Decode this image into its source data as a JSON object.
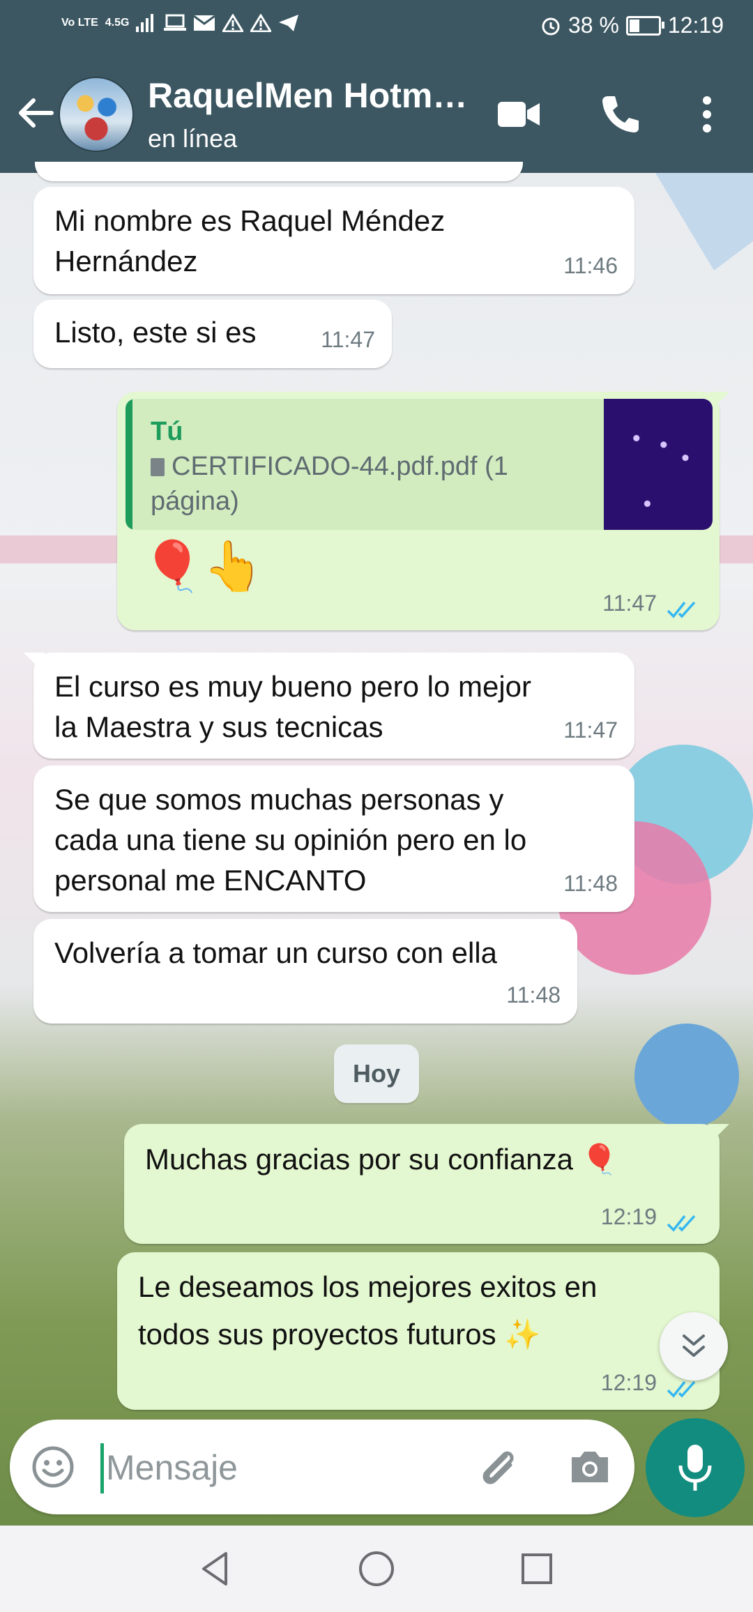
{
  "status_bar": {
    "network_labels": [
      "Vo LTE",
      "4.5G"
    ],
    "battery_percent": "38 %",
    "battery_level": 0.38,
    "time": "12:19"
  },
  "header": {
    "contact_name": "RaquelMen Hotm…",
    "contact_status": "en línea"
  },
  "messages": [
    {
      "direction": "in",
      "text": "Mi nombre es Raquel Méndez\nHernández",
      "time": "11:46"
    },
    {
      "direction": "in",
      "text": "Listo, este si es",
      "time": "11:47"
    },
    {
      "direction": "out",
      "quote_author": "Tú",
      "quote_doc": "CERTIFICADO-44.pdf.pdf (1 página)",
      "text": "🎈👆",
      "time": "11:47",
      "read": true
    },
    {
      "direction": "in",
      "text": "El curso es muy bueno pero lo mejor\nla Maestra y sus tecnicas",
      "time": "11:47"
    },
    {
      "direction": "in",
      "text": "Se que somos muchas personas y\ncada una tiene su opinión pero en lo\npersonal me ENCANTO",
      "time": "11:48"
    },
    {
      "direction": "in",
      "text": "Volvería a tomar un curso con ella",
      "time": "11:48"
    },
    {
      "direction": "out",
      "text": "Muchas gracias por su confianza 🎈",
      "time": "12:19",
      "read": true
    },
    {
      "direction": "out",
      "text": "Le deseamos los mejores exitos en\ntodos sus proyectos futuros ✨",
      "time": "12:19",
      "read": true
    }
  ],
  "date_separator": "Hoy",
  "composer": {
    "placeholder": "Mensaje"
  },
  "colors": {
    "header_bg": "#3c5762",
    "outgoing_bubble": "#e3f7d0",
    "incoming_bubble": "#ffffff",
    "accent_green": "#128c7e",
    "read_ticks": "#34b7f1"
  },
  "icons": [
    "back-arrow-icon",
    "video-call-icon",
    "phone-icon",
    "more-options-icon",
    "emoji-icon",
    "attach-icon",
    "camera-icon",
    "mic-icon",
    "chevron-double-down-icon",
    "nav-back-icon",
    "nav-home-icon",
    "nav-recents-icon"
  ]
}
